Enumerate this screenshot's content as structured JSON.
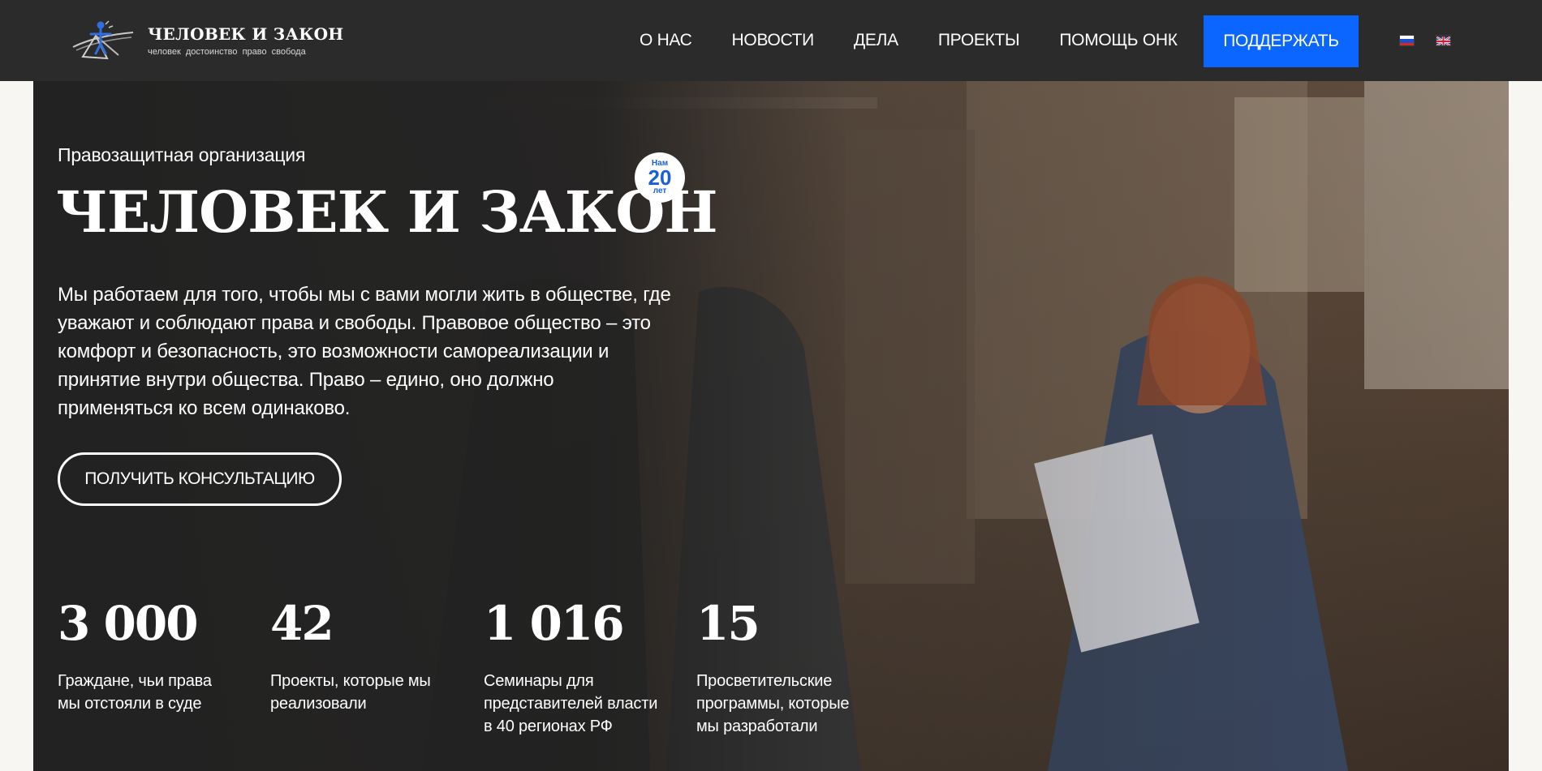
{
  "colors": {
    "header_bg": "#2b2b2b",
    "accent": "#0a66ff",
    "hero_bg": "#222222",
    "text": "#ffffff",
    "page_bg": "#f7f6f2",
    "badge_text": "#1a5fd6"
  },
  "header": {
    "logo": {
      "icon": "logo-emblem-icon",
      "title": "ЧЕЛОВЕК И ЗАКОН",
      "subtitle": "человек достоинство право свобода"
    },
    "nav": [
      {
        "label": "О НАС"
      },
      {
        "label": "НОВОСТИ"
      },
      {
        "label": "ДЕЛА"
      },
      {
        "label": "ПРОЕКТЫ"
      },
      {
        "label": "ПОМОЩЬ ОНК"
      }
    ],
    "support_label": "ПОДДЕРЖАТЬ",
    "languages": [
      {
        "code": "ru",
        "icon": "russia-flag-icon"
      },
      {
        "code": "en",
        "icon": "uk-flag-icon"
      }
    ]
  },
  "hero": {
    "eyebrow": "Правозащитная организация",
    "title": "ЧЕЛОВЕК И ЗАКОН",
    "badge": {
      "top": "Нам",
      "number": "20",
      "bottom": "лет"
    },
    "description": "Мы работаем для того, чтобы мы с вами могли жить в обществе, где уважают и соблюдают права и свободы. Правовое общество – это комфорт и безопасность, это возможности самореализации и принятие внутри общества. Право – едино, оно должно применяться ко всем одинаково.",
    "cta_label": "ПОЛУЧИТЬ КОНСУЛЬТАЦИЮ",
    "stats": [
      {
        "number": "3 000",
        "label": "Граждане, чьи права мы отстояли в суде"
      },
      {
        "number": "42",
        "label": "Проекты, которые мы реализовали"
      },
      {
        "number": "1 016",
        "label": "Семинары для представителей власти в 40 регионах РФ"
      },
      {
        "number": "15",
        "label": "Просветительские программы, которые мы разработали"
      }
    ]
  }
}
